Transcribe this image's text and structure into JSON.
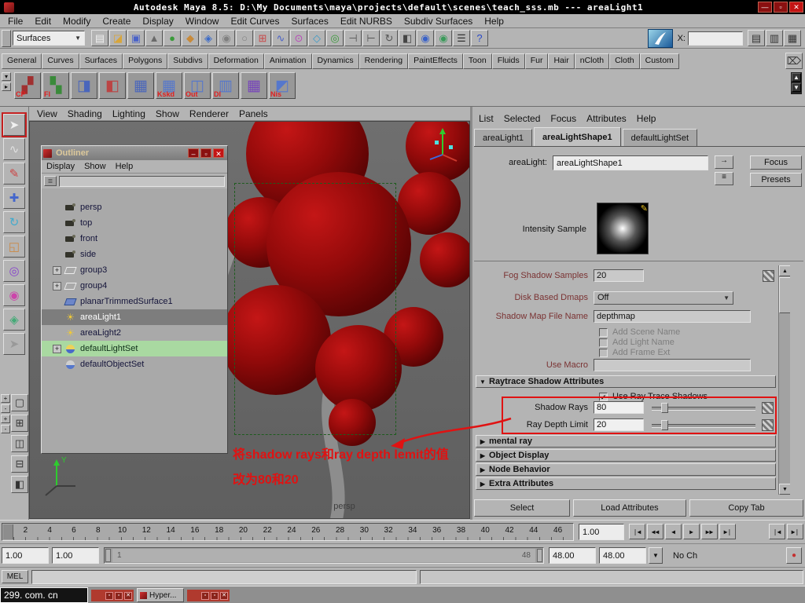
{
  "window": {
    "title": "Autodesk Maya 8.5: D:\\My Documents\\maya\\projects\\default\\scenes\\teach_sss.mb --- areaLight1",
    "minimize": "—",
    "maximize": "▫",
    "close": "✕"
  },
  "menubar": [
    "File",
    "Edit",
    "Modify",
    "Create",
    "Display",
    "Window",
    "Edit Curves",
    "Surfaces",
    "Edit NURBS",
    "Subdiv Surfaces",
    "Help"
  ],
  "statusline": {
    "menuset": "Surfaces",
    "dropdown_arrow": "▼",
    "icons": [
      {
        "name": "new-scene-icon",
        "glyph": "▤",
        "color": "#efefef"
      },
      {
        "name": "open-scene-icon",
        "glyph": "◪",
        "color": "#d8a53a"
      },
      {
        "name": "save-scene-icon",
        "glyph": "▣",
        "color": "#4a62c8"
      },
      {
        "name": "select-hierarchy-icon",
        "glyph": "▲",
        "color": "#6a6a6a"
      },
      {
        "name": "select-object-icon",
        "glyph": "●",
        "color": "#3a9a3a"
      },
      {
        "name": "select-component-icon",
        "glyph": "◆",
        "color": "#c88a3a"
      },
      {
        "name": "select-mask-icon",
        "glyph": "◈",
        "color": "#3a6ac8"
      },
      {
        "name": "lock-selection-icon",
        "glyph": "◉",
        "color": "#808080"
      },
      {
        "name": "highlight-selection-icon",
        "glyph": "○",
        "color": "#808080"
      },
      {
        "name": "snap-grid-icon",
        "glyph": "⊞",
        "color": "#c84a4a"
      },
      {
        "name": "snap-curve-icon",
        "glyph": "∿",
        "color": "#4a62c8"
      },
      {
        "name": "snap-point-icon",
        "glyph": "⊙",
        "color": "#b84ab8"
      },
      {
        "name": "snap-plane-icon",
        "glyph": "◇",
        "color": "#3a9ac8"
      },
      {
        "name": "make-live-icon",
        "glyph": "◎",
        "color": "#3a9a3a"
      },
      {
        "name": "input-connections-icon",
        "glyph": "⊣",
        "color": "#555555"
      },
      {
        "name": "output-connections-icon",
        "glyph": "⊢",
        "color": "#555555"
      },
      {
        "name": "construction-history-icon",
        "glyph": "↻",
        "color": "#555555"
      },
      {
        "name": "open-render-view-icon",
        "glyph": "◧",
        "color": "#444444"
      },
      {
        "name": "render-current-frame-icon",
        "glyph": "◉",
        "color": "#3a62c8"
      },
      {
        "name": "ipr-render-icon",
        "glyph": "◉",
        "color": "#3a9a5a"
      },
      {
        "name": "render-settings-icon",
        "glyph": "☰",
        "color": "#333333"
      },
      {
        "name": "help-icon",
        "glyph": "?",
        "color": "#2a4ac8"
      }
    ],
    "x_label": "X:",
    "x_value": "",
    "right_icons": [
      {
        "name": "attribute-editor-toggle-icon",
        "glyph": "▤",
        "color": "#333333"
      },
      {
        "name": "tool-settings-toggle-icon",
        "glyph": "▥",
        "color": "#333333"
      },
      {
        "name": "channel-box-toggle-icon",
        "glyph": "▦",
        "color": "#333333"
      }
    ]
  },
  "shelf": {
    "tabs": [
      "General",
      "Curves",
      "Surfaces",
      "Polygons",
      "Subdivs",
      "Deformation",
      "Animation",
      "Dynamics",
      "Rendering",
      "PaintEffects",
      "Toon",
      "Fluids",
      "Fur",
      "Hair",
      "nCloth",
      "Cloth",
      "Custom"
    ],
    "arrow1": "▾",
    "arrow2": "▸",
    "buttons": [
      {
        "name": "shelf-button-cp",
        "label": "CP",
        "glyph": "▞",
        "color": "#a03030"
      },
      {
        "name": "shelf-button-fi",
        "label": "FI",
        "glyph": "▚",
        "color": "#3a8a3a"
      },
      {
        "name": "shelf-button-surface1",
        "label": "",
        "glyph": "◨",
        "color": "#4a66bb"
      },
      {
        "name": "shelf-button-surface2",
        "label": "",
        "glyph": "◧",
        "color": "#bb4444"
      },
      {
        "name": "shelf-button-surface3",
        "label": "",
        "glyph": "▦",
        "color": "#4a66bb"
      },
      {
        "name": "shelf-button-kskd",
        "label": "Kskd",
        "glyph": "▦",
        "color": "#5577cc"
      },
      {
        "name": "shelf-button-out",
        "label": "Out",
        "glyph": "◫",
        "color": "#5577cc"
      },
      {
        "name": "shelf-button-di",
        "label": "DI",
        "glyph": "▥",
        "color": "#5577cc"
      },
      {
        "name": "shelf-button-surface4",
        "label": "",
        "glyph": "▦",
        "color": "#7744bb"
      },
      {
        "name": "shelf-button-nis",
        "label": "Nis",
        "glyph": "◩",
        "color": "#5577cc"
      }
    ],
    "scroll_up": "▲",
    "scroll_down": "▼",
    "trash_glyph": "⌦"
  },
  "toolbox": {
    "tools": [
      {
        "name": "select-tool",
        "glyph": "➤",
        "color": "#f0f0f0"
      },
      {
        "name": "lasso-tool",
        "glyph": "∿",
        "color": "#e0e0e0"
      },
      {
        "name": "paint-select-tool",
        "glyph": "✎",
        "color": "#cc4444"
      },
      {
        "name": "move-tool",
        "glyph": "✚",
        "color": "#4466cc"
      },
      {
        "name": "rotate-tool",
        "glyph": "↻",
        "color": "#44aacc"
      },
      {
        "name": "scale-tool",
        "glyph": "◱",
        "color": "#cc8844"
      },
      {
        "name": "universal-manipulator-tool",
        "glyph": "◎",
        "color": "#8844cc"
      },
      {
        "name": "soft-mod-tool",
        "glyph": "◉",
        "color": "#cc44aa"
      },
      {
        "name": "show-manipulator-tool",
        "glyph": "◈",
        "color": "#44aa77"
      },
      {
        "name": "last-tool",
        "glyph": "➤",
        "color": "#999999"
      }
    ],
    "quick": [
      "+",
      "-",
      "+",
      "-"
    ],
    "layouts": [
      {
        "name": "layout-single-pane-button",
        "glyph": "▢"
      },
      {
        "name": "layout-four-pane-button",
        "glyph": "⊞"
      },
      {
        "name": "layout-two-pane-side-button",
        "glyph": "◫"
      },
      {
        "name": "layout-two-pane-stacked-button",
        "glyph": "⊟"
      },
      {
        "name": "layout-three-pane-button",
        "glyph": "◧"
      }
    ]
  },
  "viewport": {
    "menu": [
      "View",
      "Shading",
      "Lighting",
      "Show",
      "Renderer",
      "Panels"
    ],
    "camera_label": "persp",
    "axis_y": "Y",
    "annotation": {
      "line1": "将shadow rays和ray depth lemit的值",
      "line2": "改为80和20"
    }
  },
  "outliner": {
    "title": "Outliner",
    "minimize": "–",
    "maximize": "▫",
    "close": "✕",
    "menu": [
      "Display",
      "Show",
      "Help"
    ],
    "items": [
      {
        "label": "persp",
        "expand": ""
      },
      {
        "label": "top",
        "expand": ""
      },
      {
        "label": "front",
        "expand": ""
      },
      {
        "label": "side",
        "expand": ""
      },
      {
        "label": "group3",
        "expand": "+"
      },
      {
        "label": "group4",
        "expand": "+"
      },
      {
        "label": "planarTrimmedSurface1",
        "expand": ""
      },
      {
        "label": "areaLight1",
        "expand": ""
      },
      {
        "label": "areaLight2",
        "expand": ""
      },
      {
        "label": "defaultLightSet",
        "expand": "+"
      },
      {
        "label": "defaultObjectSet",
        "expand": ""
      }
    ]
  },
  "ae": {
    "menu": [
      "List",
      "Selected",
      "Focus",
      "Attributes",
      "Help"
    ],
    "tabs": [
      "areaLight1",
      "areaLightShape1",
      "defaultLightSet"
    ],
    "node_type_label": "areaLight:",
    "node_name": "areaLightShape1",
    "focus_icon": "→",
    "list_icon": "≡",
    "focus_button": "Focus",
    "presets_button": "Presets",
    "intensity_sample_label": "Intensity Sample",
    "swatch_pen": "✎",
    "fog_shadow_samples_label": "Fog Shadow Samples",
    "fog_shadow_samples_value": "20",
    "disk_based_dmaps_label": "Disk Based Dmaps",
    "disk_based_dmaps_value": "Off",
    "shadow_map_file_label": "Shadow Map File Name",
    "shadow_map_file_value": "depthmap",
    "add_scene_name_label": "Add Scene Name",
    "add_light_name_label": "Add Light Name",
    "add_frame_ext_label": "Add Frame Ext",
    "use_macro_label": "Use Macro",
    "use_macro_value": "",
    "raytrace_arrow": "▼",
    "raytrace_section_label": "Raytrace Shadow Attributes",
    "check_glyph": "✔",
    "use_ray_trace_label": "Use Ray Trace Shadows",
    "shadow_rays_label": "Shadow Rays",
    "shadow_rays_value": "80",
    "ray_depth_limit_label": "Ray Depth Limit",
    "ray_depth_limit_value": "20",
    "sections": [
      {
        "label": "mental ray",
        "arrow": "▶"
      },
      {
        "label": "Object Display",
        "arrow": "▶"
      },
      {
        "label": "Node Behavior",
        "arrow": "▶"
      },
      {
        "label": "Extra Attributes",
        "arrow": "▶"
      }
    ],
    "scroll_up": "▲",
    "scroll_down": "▼",
    "select_button": "Select",
    "load_attributes_button": "Load Attributes",
    "copy_tab_button": "Copy Tab",
    "accent_red": "#e01212"
  },
  "timeline": {
    "ticks": [
      "2",
      "4",
      "6",
      "8",
      "10",
      "12",
      "14",
      "16",
      "18",
      "20",
      "22",
      "24",
      "26",
      "28",
      "30",
      "32",
      "34",
      "36",
      "38",
      "40",
      "42",
      "44",
      "46"
    ],
    "current_time": "1.00",
    "playback": [
      "|◀",
      "◀◀",
      "◀",
      "▶",
      "▶▶",
      "▶|"
    ],
    "key_steps": [
      "|◀",
      "▶|"
    ]
  },
  "range": {
    "start": "1.00",
    "anim_start": "1.00",
    "range_start": "1",
    "range_end": "48",
    "anim_end": "48.00",
    "end": "48.00",
    "dropdown_arrow": "▼",
    "character": "No Ch",
    "autokey_glyph": "●"
  },
  "command_line": {
    "label": "MEL",
    "value": "",
    "result": ""
  },
  "taskbar": {
    "watermark": "299. com. cn",
    "min_glyph": "▫",
    "close_glyph": "✕",
    "hypershade": "Hyper..."
  }
}
